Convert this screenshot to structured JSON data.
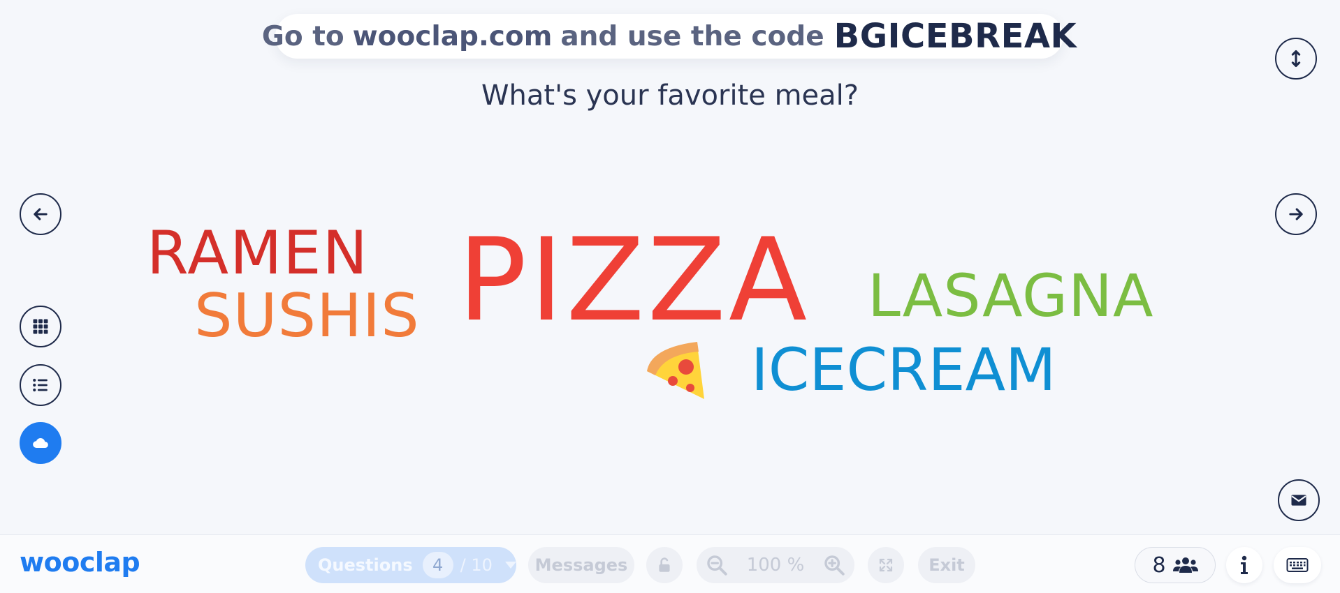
{
  "banner": {
    "prefix": "Go to",
    "site": "wooclap.com",
    "middle": "and use the code",
    "code": "BGICEBREAK"
  },
  "question": "What's your favorite meal?",
  "words": [
    {
      "text": "RAMEN",
      "color": "#d42f2a"
    },
    {
      "text": "SUSHIS",
      "color": "#f17b3a"
    },
    {
      "text": "PIZZA",
      "color": "#ef4036"
    },
    {
      "text": "LASAGNA",
      "color": "#7bbd42"
    },
    {
      "text": "ICECREAM",
      "color": "#0f8fd3"
    }
  ],
  "side_icons": {
    "prev": "arrow-left-icon",
    "next": "arrow-right-icon",
    "resize": "vertical-resize-icon",
    "grid": "grid-icon",
    "list": "list-icon",
    "cloud": "cloud-icon",
    "mail": "envelope-icon"
  },
  "bottom": {
    "logo": "wooclap",
    "questions_label": "Questions",
    "current_question": "4",
    "total_questions": "/ 10",
    "messages_label": "Messages",
    "zoom_value": "100 %",
    "exit_label": "Exit",
    "participants": "8"
  },
  "colors": {
    "accent": "#1f7cf0",
    "dark": "#1e2a4a"
  }
}
